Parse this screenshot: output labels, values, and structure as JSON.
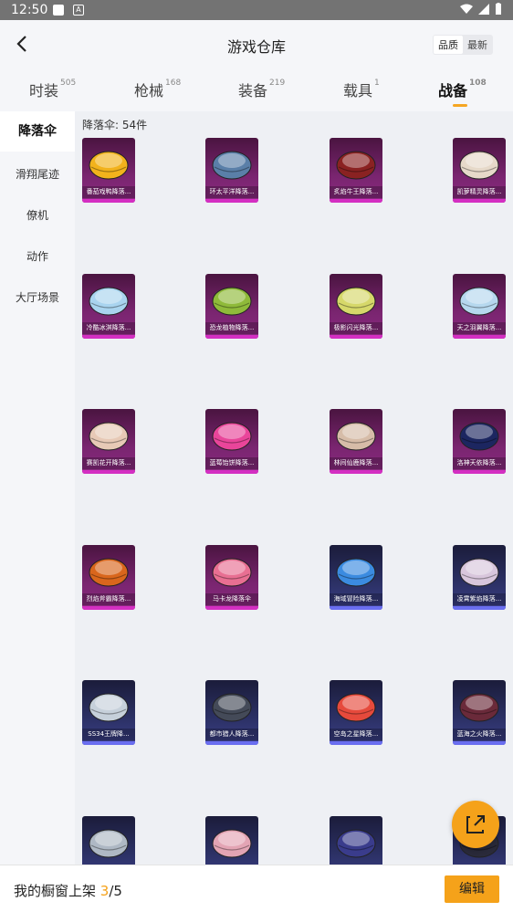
{
  "status": {
    "time": "12:50"
  },
  "header": {
    "title": "游戏仓库",
    "sort": [
      "品质",
      "最新"
    ]
  },
  "tabs": [
    {
      "label": "时装",
      "count": "505"
    },
    {
      "label": "枪械",
      "count": "168"
    },
    {
      "label": "装备",
      "count": "219"
    },
    {
      "label": "载具",
      "count": "1"
    },
    {
      "label": "战备",
      "count": "108"
    }
  ],
  "sidebar": [
    "降落伞",
    "滑翔尾迹",
    "僚机",
    "动作",
    "大厅场景"
  ],
  "content": {
    "count_label": "降落伞: 54件"
  },
  "items": [
    {
      "name": "番茄戏鸭降落...",
      "rarity": "purple",
      "color": "#f2b21c"
    },
    {
      "name": "环太平洋降落...",
      "rarity": "purple",
      "color": "#5a7fa8"
    },
    {
      "name": "炙焰牛王降落...",
      "rarity": "purple",
      "color": "#8a2222"
    },
    {
      "name": "凯萝精灵降落...",
      "rarity": "purple",
      "color": "#e6d9c9"
    },
    {
      "name": "冷酷冰淇降落...",
      "rarity": "purple",
      "color": "#a9d4ef"
    },
    {
      "name": "恐龙植物降落...",
      "rarity": "purple",
      "color": "#8fba3a"
    },
    {
      "name": "极影闪光降落...",
      "rarity": "purple",
      "color": "#d6d86a"
    },
    {
      "name": "天之羽翼降落...",
      "rarity": "purple",
      "color": "#b6d8ee"
    },
    {
      "name": "赛凯花开降落...",
      "rarity": "purple",
      "color": "#e7c9b6"
    },
    {
      "name": "蓝莓饴饼降落...",
      "rarity": "purple",
      "color": "#e9459a"
    },
    {
      "name": "林间仙鹿降落...",
      "rarity": "purple",
      "color": "#d6bca8"
    },
    {
      "name": "洛神天依降落...",
      "rarity": "purple",
      "color": "#1c2660"
    },
    {
      "name": "烈焰斧霸降落...",
      "rarity": "purple",
      "color": "#d9661c"
    },
    {
      "name": "马卡龙降落伞",
      "rarity": "purple",
      "color": "#e86f92"
    },
    {
      "name": "海域冒险降落...",
      "rarity": "blue",
      "color": "#3b8be0"
    },
    {
      "name": "凌霄紫焰降落...",
      "rarity": "blue",
      "color": "#d8c6dc"
    },
    {
      "name": "SS34王牌降...",
      "rarity": "blue",
      "color": "#c6d0da"
    },
    {
      "name": "都市猎人降落...",
      "rarity": "blue",
      "color": "#444a58"
    },
    {
      "name": "空岛之星降落...",
      "rarity": "blue",
      "color": "#e64a3c"
    },
    {
      "name": "蓝海之火降落...",
      "rarity": "blue",
      "color": "#6a2a3a"
    },
    {
      "name": "",
      "rarity": "blue",
      "color": "#aeb8c4"
    },
    {
      "name": "",
      "rarity": "blue",
      "color": "#e3a4b4"
    },
    {
      "name": "",
      "rarity": "blue",
      "color": "#3a3c8c"
    },
    {
      "name": "",
      "rarity": "blue",
      "color": "#2a2a3a"
    }
  ],
  "footer": {
    "label": "我的橱窗上架",
    "current": "3",
    "separator": "/",
    "total": "5",
    "edit": "编辑"
  },
  "colors": {
    "accent": "#f5a21a",
    "purple_bar": "#d42fc2",
    "blue_bar": "#6a6ef0"
  }
}
